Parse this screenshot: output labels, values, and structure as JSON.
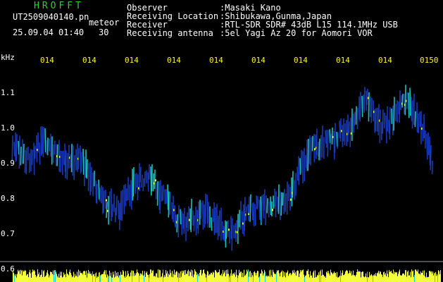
{
  "header": {
    "brand": "HROFFT",
    "filename": "UT2509040140.pn",
    "mode": "meteor",
    "datetime": "25.09.04 01:40",
    "duration": "30",
    "info_labels": [
      "Observer",
      "Receiving Location",
      "Receiver",
      "Receiving antenna"
    ],
    "info_values": [
      ":Masaki Kano",
      ":Shibukawa,Gunma,Japan",
      ":RTL-SDR SDR# 43dB L15 114.1MHz USB",
      ":5el Yagi Az 20 for Aomori VOR"
    ]
  },
  "spectrogram": {
    "y_unit": "kHz",
    "y_ticks": [
      "1.1",
      "1.0",
      "0.9",
      "0.8",
      "0.7",
      "0.6"
    ],
    "time_ticks": [
      "014",
      "014",
      "014",
      "014",
      "014",
      "014",
      "014",
      "014",
      "014",
      "0150"
    ],
    "colors": {
      "background": "#000000",
      "trace_low": "#1a3fd0",
      "trace_high": "#18d7d0",
      "peak": "#f2ff3a",
      "axis_text": "#ffeb3b"
    }
  }
}
